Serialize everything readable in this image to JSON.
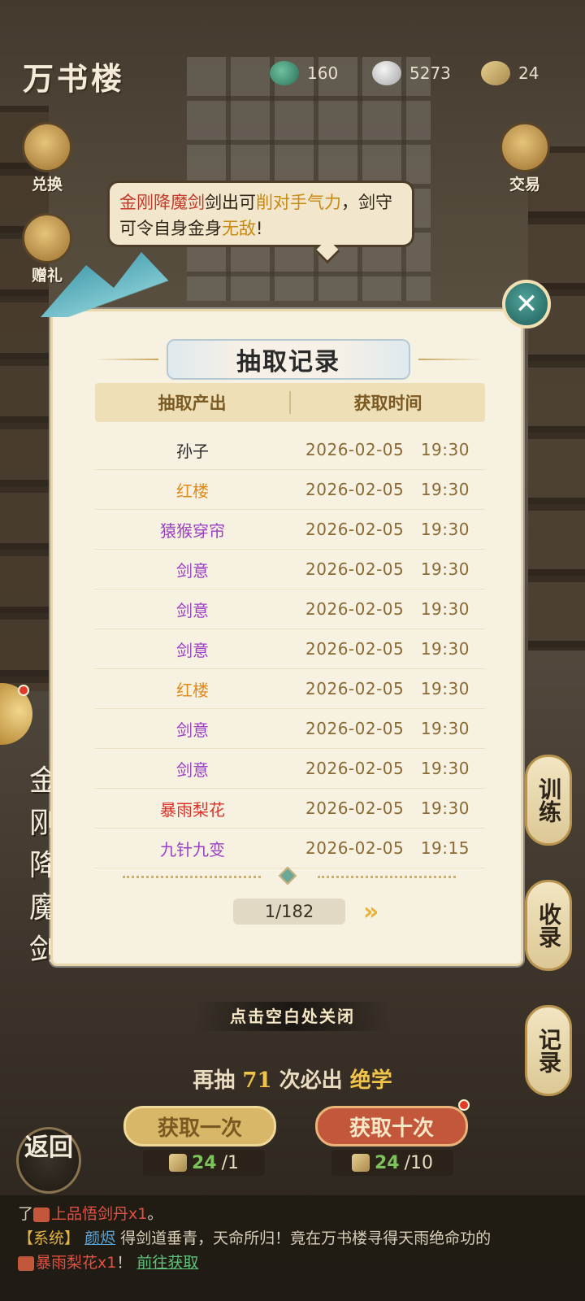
{
  "header": {
    "title": "万书楼",
    "resources": [
      {
        "icon": "jade-dragon-icon",
        "value": "160"
      },
      {
        "icon": "silver-ingot-icon",
        "value": "5273"
      },
      {
        "icon": "scroll-ticket-icon",
        "value": "24"
      }
    ]
  },
  "side": {
    "exchange": "兑换",
    "gift": "赠礼",
    "trade": "交易"
  },
  "bubble": {
    "p1": "金刚降魔剑",
    "p2": "剑出可",
    "p3": "削对手气力",
    "p4": "，剑守可令自身金身",
    "p5": "无敌",
    "p6": "!"
  },
  "modal": {
    "title": "抽取记录",
    "col_item": "抽取产出",
    "col_time": "获取时间",
    "rows": [
      {
        "item": "孙子",
        "time": "2026-02-05   19:30",
        "color": "#2a2a2a"
      },
      {
        "item": "红楼",
        "time": "2026-02-05   19:30",
        "color": "#e08a1c"
      },
      {
        "item": "猿猴穿帘",
        "time": "2026-02-05   19:30",
        "color": "#9a3fc2"
      },
      {
        "item": "剑意",
        "time": "2026-02-05   19:30",
        "color": "#9a3fc2"
      },
      {
        "item": "剑意",
        "time": "2026-02-05   19:30",
        "color": "#9a3fc2"
      },
      {
        "item": "剑意",
        "time": "2026-02-05   19:30",
        "color": "#9a3fc2"
      },
      {
        "item": "红楼",
        "time": "2026-02-05   19:30",
        "color": "#e08a1c"
      },
      {
        "item": "剑意",
        "time": "2026-02-05   19:30",
        "color": "#9a3fc2"
      },
      {
        "item": "剑意",
        "time": "2026-02-05   19:30",
        "color": "#9a3fc2"
      },
      {
        "item": "暴雨梨花",
        "time": "2026-02-05   19:30",
        "color": "#d8322a"
      },
      {
        "item": "九针九变",
        "time": "2026-02-05   19:15",
        "color": "#9a3fc2"
      }
    ],
    "pager": "1/182",
    "next": "»"
  },
  "close_hint": "点击空白处关闭",
  "left_vertical": "金刚降魔剑",
  "right_tabs": {
    "train": "训练",
    "collect": "收录",
    "record": "记录"
  },
  "guarantee": {
    "pre": "再抽",
    "num": "71",
    "post": "次必出",
    "tail": "绝学"
  },
  "draw": {
    "once": "获取一次",
    "ten": "获取十次",
    "cost_once_have": "24",
    "cost_once_need": "/1",
    "cost_ten_have": "24",
    "cost_ten_need": "/10"
  },
  "back": "返回",
  "ticker": {
    "line1_pre": "了",
    "line1_item": "上品悟剑丹x1",
    "line1_post": "。",
    "line2_tag": "【系统】",
    "line2_user": "颜烬",
    "line2_text": "得剑道垂青，天命所归！竟在万书楼寻得天雨绝命功的",
    "line3_item": "暴雨梨花x1",
    "line3_mid": "！",
    "line3_link": "前往获取"
  }
}
